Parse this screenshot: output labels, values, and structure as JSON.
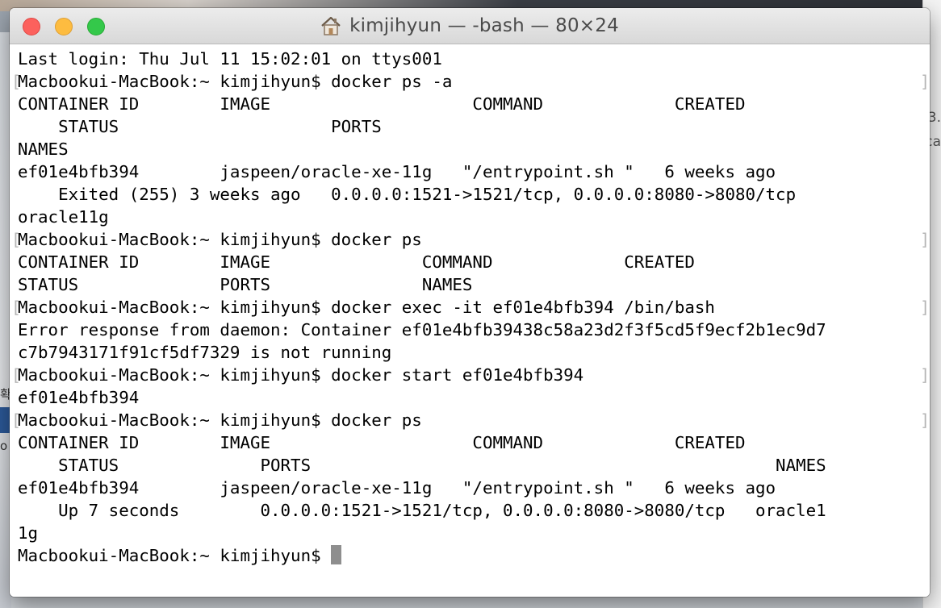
{
  "window": {
    "title": "kimjihyun — -bash — 80×24",
    "title_icon": "home-icon"
  },
  "background": {
    "right_fragments": [
      "3.",
      "ca"
    ],
    "left_fragments": [
      "확",
      "o"
    ]
  },
  "terminal": {
    "lines": [
      "Last login: Thu Jul 11 15:02:01 on ttys001",
      "Macbookui-MacBook:~ kimjihyun$ docker ps -a",
      "CONTAINER ID        IMAGE                    COMMAND             CREATED",
      "    STATUS                     PORTS",
      "NAMES",
      "ef01e4bfb394        jaspeen/oracle-xe-11g   \"/entrypoint.sh \"   6 weeks ago",
      "    Exited (255) 3 weeks ago   0.0.0.0:1521->1521/tcp, 0.0.0.0:8080->8080/tcp",
      "oracle11g",
      "Macbookui-MacBook:~ kimjihyun$ docker ps",
      "CONTAINER ID        IMAGE               COMMAND             CREATED",
      "STATUS              PORTS               NAMES",
      "Macbookui-MacBook:~ kimjihyun$ docker exec -it ef01e4bfb394 /bin/bash",
      "Error response from daemon: Container ef01e4bfb39438c58a23d2f3f5cd5f9ecf2b1ec9d7",
      "c7b7943171f91cf5df7329 is not running",
      "Macbookui-MacBook:~ kimjihyun$ docker start ef01e4bfb394",
      "ef01e4bfb394",
      "Macbookui-MacBook:~ kimjihyun$ docker ps",
      "CONTAINER ID        IMAGE                    COMMAND             CREATED",
      "    STATUS              PORTS                                              NAMES",
      "ef01e4bfb394        jaspeen/oracle-xe-11g   \"/entrypoint.sh \"   6 weeks ago",
      "    Up 7 seconds        0.0.0.0:1521->1521/tcp, 0.0.0.0:8080->8080/tcp   oracle1",
      "1g"
    ],
    "prompt": "Macbookui-MacBook:~ kimjihyun$ ",
    "bracketed_line_indexes": [
      1,
      8,
      11,
      14,
      16
    ],
    "cursor_color": "#8e8e8e"
  }
}
